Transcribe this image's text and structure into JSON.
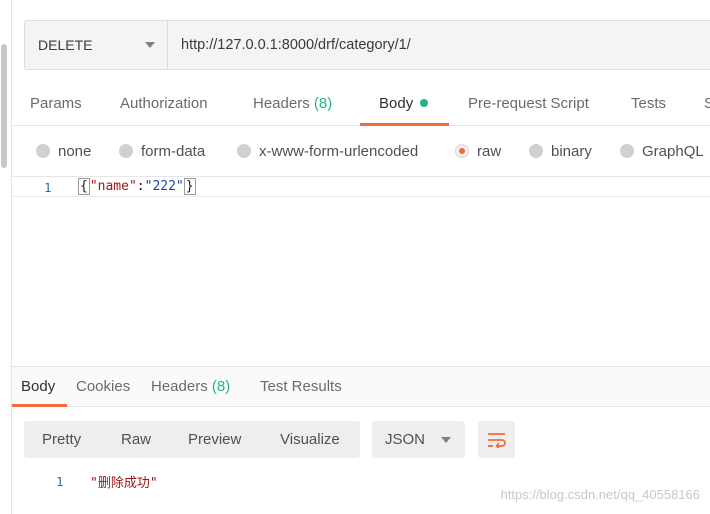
{
  "request": {
    "method": "DELETE",
    "url": "http://127.0.0.1:8000/drf/category/1/"
  },
  "request_tabs": [
    {
      "label": "Params"
    },
    {
      "label": "Authorization"
    },
    {
      "label": "Headers",
      "count": "(8)"
    },
    {
      "label": "Body",
      "active": true
    },
    {
      "label": "Pre-request Script"
    },
    {
      "label": "Tests"
    },
    {
      "label": "S"
    }
  ],
  "body_types": [
    {
      "label": "none"
    },
    {
      "label": "form-data"
    },
    {
      "label": "x-www-form-urlencoded"
    },
    {
      "label": "raw",
      "selected": true
    },
    {
      "label": "binary"
    },
    {
      "label": "GraphQL"
    }
  ],
  "editor": {
    "line_number": "1",
    "code": {
      "open_brace": "{",
      "key": "\"name\"",
      "colon": ":",
      "value": "\"222\"",
      "close_brace": "}"
    }
  },
  "response_tabs": [
    {
      "label": "Body",
      "active": true
    },
    {
      "label": "Cookies"
    },
    {
      "label": "Headers",
      "count": "(8)"
    },
    {
      "label": "Test Results"
    }
  ],
  "response_view": {
    "modes": [
      "Pretty",
      "Raw",
      "Preview",
      "Visualize"
    ],
    "format": "JSON",
    "wrap_icon": "wrap-lines-icon"
  },
  "response_body": {
    "line_number": "1",
    "text": "\"删除成功\""
  },
  "watermark": "https://blog.csdn.net/qq_40558166",
  "colors": {
    "accent": "#f26b3a",
    "status_green": "#26b47f"
  }
}
